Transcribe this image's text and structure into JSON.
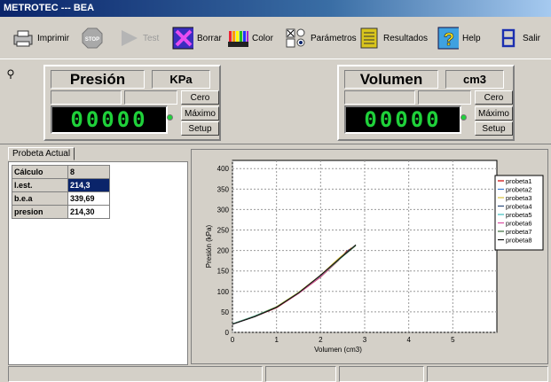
{
  "window": {
    "title": "METROTEC --- BEA"
  },
  "toolbar": {
    "print": "Imprimir",
    "stop_icon_text": "STOP",
    "test": "Test",
    "erase": "Borrar",
    "color": "Color",
    "params": "Parámetros",
    "results": "Resultados",
    "help": "Help",
    "exit": "Salir"
  },
  "pressure_panel": {
    "title": "Presión",
    "unit": "KPa",
    "reading": "00000",
    "zero": "Cero",
    "max": "Máximo",
    "setup": "Setup"
  },
  "volume_panel": {
    "title": "Volumen",
    "unit": "cm3",
    "reading": "00000",
    "zero": "Cero",
    "max": "Máximo",
    "setup": "Setup"
  },
  "results_tab": {
    "label": "Probeta Actual",
    "rows": [
      {
        "name": "Cálculo",
        "value": "8"
      },
      {
        "name": "l.est.",
        "value": "214,3"
      },
      {
        "name": "b.e.a",
        "value": "339,69"
      },
      {
        "name": "presion",
        "value": "214,30"
      }
    ]
  },
  "chart_data": {
    "type": "line",
    "title": "",
    "xlabel": "Volumen (cm3)",
    "ylabel": "Presión (kPa)",
    "xlim": [
      0,
      6
    ],
    "ylim": [
      0,
      420
    ],
    "xticks": [
      "0",
      "1",
      "2",
      "3",
      "4",
      "5"
    ],
    "yticks": [
      "0",
      "50",
      "100",
      "150",
      "200",
      "250",
      "300",
      "350",
      "400"
    ],
    "grid": true,
    "legend_position": "right",
    "series": [
      {
        "name": "probeta1",
        "color": "#cc0000",
        "x": [
          0,
          0.5,
          1,
          1.5,
          2,
          2.4,
          2.6
        ],
        "y": [
          20,
          38,
          60,
          95,
          135,
          175,
          200
        ]
      },
      {
        "name": "probeta2",
        "color": "#3a7bd5",
        "x": [
          0,
          0.5,
          1,
          1.5,
          2,
          2.4,
          2.7
        ],
        "y": [
          20,
          39,
          62,
          97,
          138,
          178,
          205
        ]
      },
      {
        "name": "probeta3",
        "color": "#d8c23a",
        "x": [
          0,
          0.5,
          1,
          1.5,
          2,
          2.4,
          2.7
        ],
        "y": [
          21,
          40,
          63,
          98,
          140,
          180,
          207
        ]
      },
      {
        "name": "probeta4",
        "color": "#2a4a7a",
        "x": [
          0,
          0.5,
          1,
          1.5,
          2,
          2.4,
          2.65
        ],
        "y": [
          20,
          38,
          61,
          96,
          137,
          176,
          203
        ]
      },
      {
        "name": "probeta5",
        "color": "#3fbfbf",
        "x": [
          0,
          0.5,
          1,
          1.5,
          2,
          2.4,
          2.75
        ],
        "y": [
          21,
          40,
          62,
          96,
          136,
          176,
          208
        ]
      },
      {
        "name": "probeta6",
        "color": "#d94fa3",
        "x": [
          0,
          0.5,
          1,
          1.5,
          2,
          2.4,
          2.7
        ],
        "y": [
          20,
          39,
          61,
          95,
          136,
          177,
          206
        ]
      },
      {
        "name": "probeta7",
        "color": "#3a6a3a",
        "x": [
          0,
          0.5,
          1,
          1.5,
          2,
          2.45,
          2.8
        ],
        "y": [
          20,
          39,
          62,
          97,
          139,
          181,
          212
        ]
      },
      {
        "name": "probeta8",
        "color": "#111111",
        "x": [
          0,
          0.5,
          1,
          1.5,
          2,
          2.45,
          2.8
        ],
        "y": [
          20,
          38,
          61,
          96,
          140,
          182,
          214
        ]
      }
    ]
  },
  "colors": {
    "lcd_green": "#1fd13a",
    "title_bar": "#0a246a",
    "selected_cell": "#0a246a"
  }
}
